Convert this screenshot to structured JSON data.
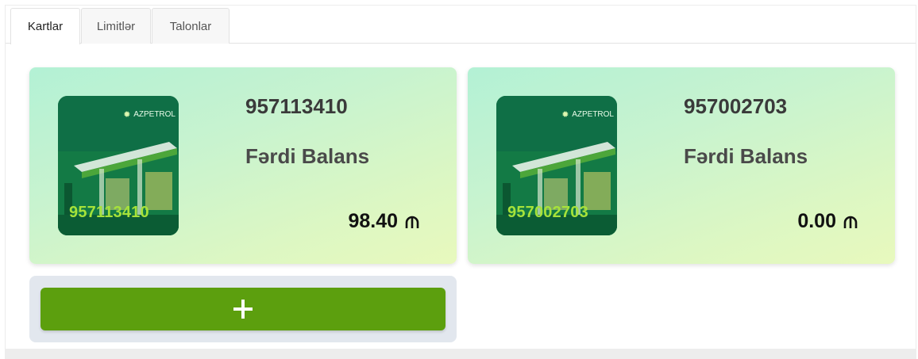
{
  "tabs": [
    {
      "label": "Kartlar",
      "active": true
    },
    {
      "label": "Limitlər",
      "active": false
    },
    {
      "label": "Talonlar",
      "active": false
    }
  ],
  "brand_name": "AZPETROL",
  "cards": [
    {
      "number": "957113410",
      "type": "Fərdi Balans",
      "balance": "98.40",
      "currency_icon": "manat-icon"
    },
    {
      "number": "957002703",
      "type": "Fərdi Balans",
      "balance": "0.00",
      "currency_icon": "manat-icon"
    }
  ],
  "add_button": {
    "icon": "plus-icon"
  },
  "colors": {
    "accent_green": "#5c9f0e",
    "image_number": "#a6e23a",
    "card_gradient_start": "#b3f1d5",
    "card_gradient_end": "#e8f9bd"
  }
}
